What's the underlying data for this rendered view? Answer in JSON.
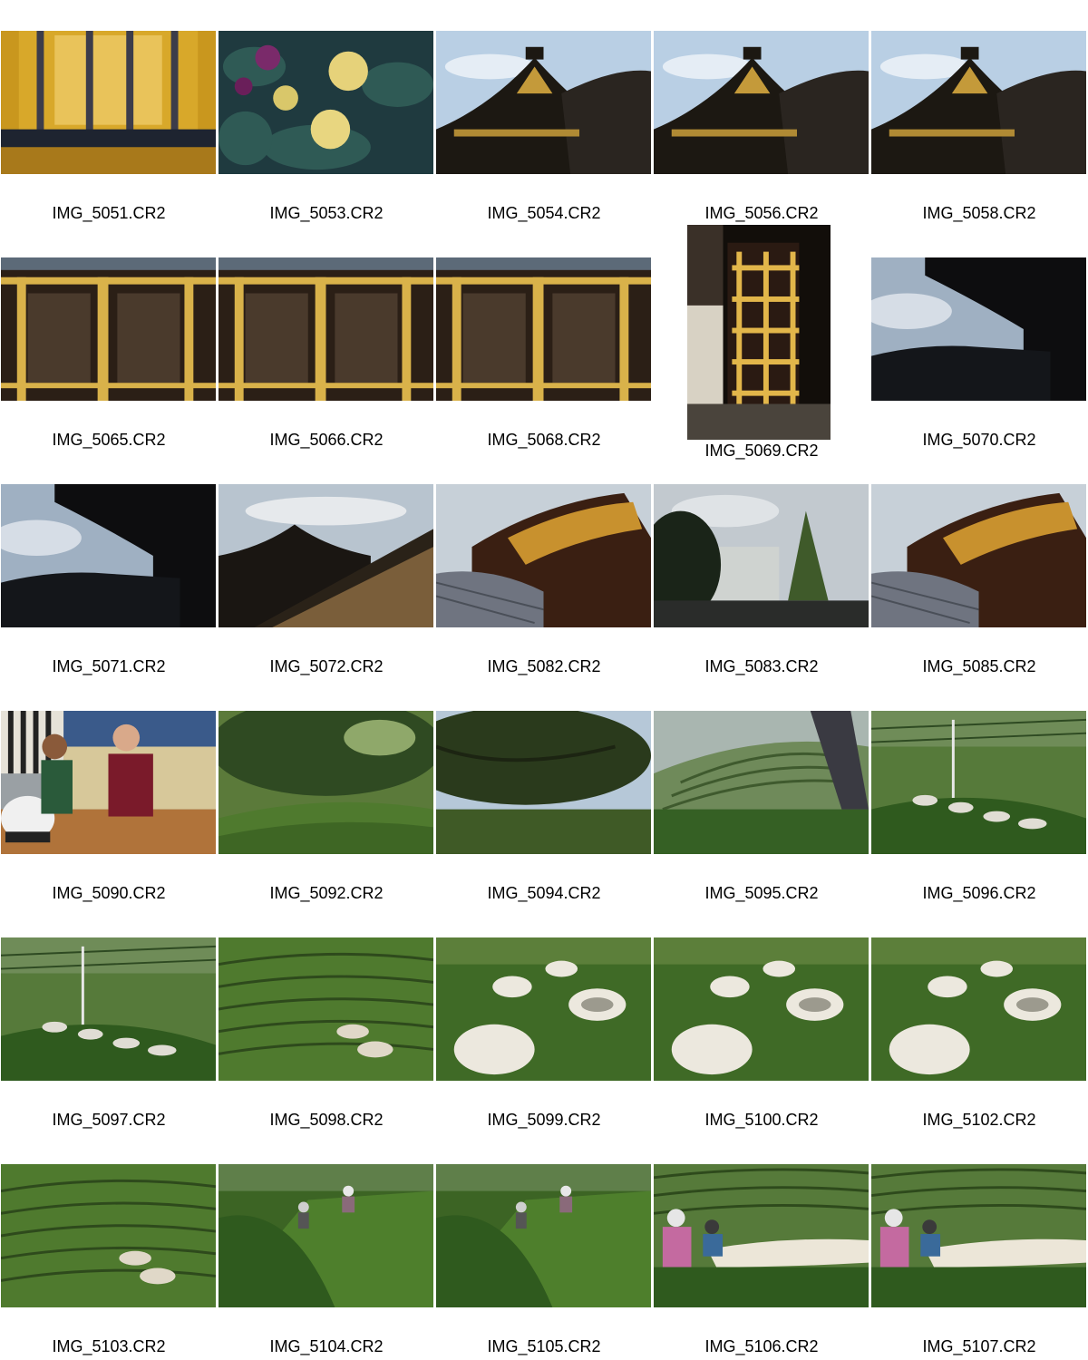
{
  "photos": [
    {
      "file": "IMG_5051.CR2",
      "orientation": "landscape",
      "scene": "temple-interior"
    },
    {
      "file": "IMG_5053.CR2",
      "orientation": "landscape",
      "scene": "chrysanthemums"
    },
    {
      "file": "IMG_5054.CR2",
      "orientation": "landscape",
      "scene": "gate-roof"
    },
    {
      "file": "IMG_5056.CR2",
      "orientation": "landscape",
      "scene": "gate-roof"
    },
    {
      "file": "IMG_5058.CR2",
      "orientation": "landscape",
      "scene": "gate-roof"
    },
    {
      "file": "IMG_5065.CR2",
      "orientation": "landscape",
      "scene": "carved-door"
    },
    {
      "file": "IMG_5066.CR2",
      "orientation": "landscape",
      "scene": "carved-door"
    },
    {
      "file": "IMG_5068.CR2",
      "orientation": "landscape",
      "scene": "carved-door"
    },
    {
      "file": "IMG_5069.CR2",
      "orientation": "portrait",
      "scene": "gold-gate-door"
    },
    {
      "file": "IMG_5070.CR2",
      "orientation": "landscape",
      "scene": "roof-silhouette"
    },
    {
      "file": "IMG_5071.CR2",
      "orientation": "landscape",
      "scene": "roof-silhouette"
    },
    {
      "file": "IMG_5072.CR2",
      "orientation": "landscape",
      "scene": "temple-wall"
    },
    {
      "file": "IMG_5082.CR2",
      "orientation": "landscape",
      "scene": "ornate-gate"
    },
    {
      "file": "IMG_5083.CR2",
      "orientation": "landscape",
      "scene": "trees-street"
    },
    {
      "file": "IMG_5085.CR2",
      "orientation": "landscape",
      "scene": "ornate-gate"
    },
    {
      "file": "IMG_5090.CR2",
      "orientation": "landscape",
      "scene": "people-indoors"
    },
    {
      "file": "IMG_5092.CR2",
      "orientation": "landscape",
      "scene": "tea-field-tree"
    },
    {
      "file": "IMG_5094.CR2",
      "orientation": "landscape",
      "scene": "tree-sky"
    },
    {
      "file": "IMG_5095.CR2",
      "orientation": "landscape",
      "scene": "tea-terraces"
    },
    {
      "file": "IMG_5096.CR2",
      "orientation": "landscape",
      "scene": "tea-field-sacks"
    },
    {
      "file": "IMG_5097.CR2",
      "orientation": "landscape",
      "scene": "tea-field-sacks"
    },
    {
      "file": "IMG_5098.CR2",
      "orientation": "landscape",
      "scene": "tea-rows"
    },
    {
      "file": "IMG_5099.CR2",
      "orientation": "landscape",
      "scene": "tea-sacks-close"
    },
    {
      "file": "IMG_5100.CR2",
      "orientation": "landscape",
      "scene": "tea-sacks-close"
    },
    {
      "file": "IMG_5102.CR2",
      "orientation": "landscape",
      "scene": "tea-sacks-close"
    },
    {
      "file": "IMG_5103.CR2",
      "orientation": "landscape",
      "scene": "tea-rows"
    },
    {
      "file": "IMG_5104.CR2",
      "orientation": "landscape",
      "scene": "tea-pickers"
    },
    {
      "file": "IMG_5105.CR2",
      "orientation": "landscape",
      "scene": "tea-pickers"
    },
    {
      "file": "IMG_5106.CR2",
      "orientation": "landscape",
      "scene": "tea-harvest-workers"
    },
    {
      "file": "IMG_5107.CR2",
      "orientation": "landscape",
      "scene": "tea-harvest-workers"
    }
  ]
}
